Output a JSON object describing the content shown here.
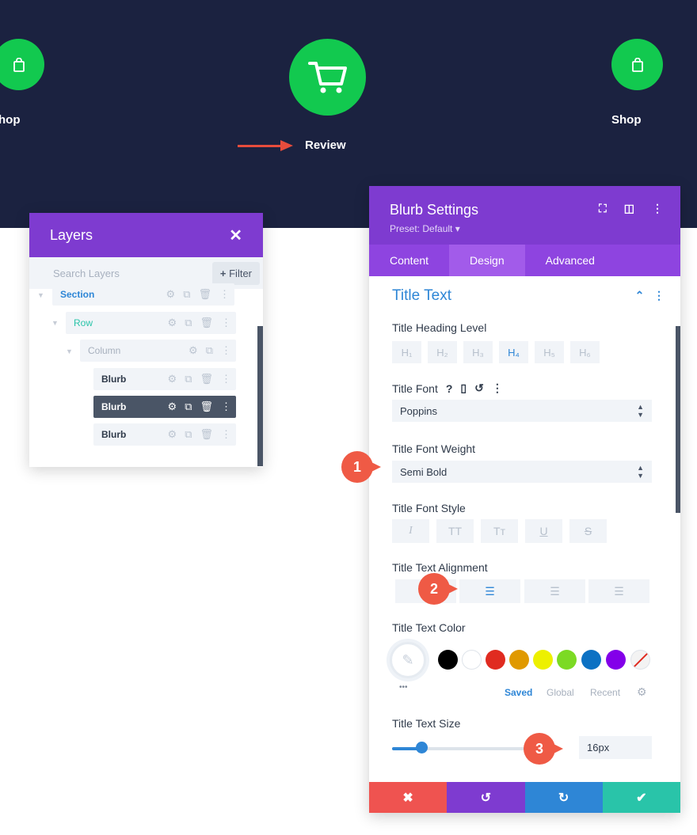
{
  "hero": {
    "left_label": "hop",
    "center_label": "Review",
    "right_label": "Shop",
    "accent": "#12c94f",
    "background": "#1b2240",
    "arrow_color": "#e74c3c",
    "icons": {
      "left": "shopping-bag-icon",
      "center": "shopping-cart-icon",
      "right": "shopping-bag-icon"
    }
  },
  "layers": {
    "title": "Layers",
    "close_icon": "close-icon",
    "search_placeholder": "Search Layers",
    "filter_label": "Filter",
    "filter_prefix": "+",
    "tree": [
      {
        "label": "Section",
        "color": "#2e86d6"
      },
      {
        "label": "Row",
        "color": "#29c4a9"
      },
      {
        "label": "Column",
        "color": "#a7b0bd"
      },
      {
        "label": "Blurb",
        "color": "#2f3a4a"
      },
      {
        "label": "Blurb",
        "color": "#ffffff",
        "selected": true
      },
      {
        "label": "Blurb",
        "color": "#2f3a4a"
      }
    ]
  },
  "settings": {
    "title": "Blurb Settings",
    "preset": "Preset: Default ▾",
    "tabs": [
      "Content",
      "Design",
      "Advanced"
    ],
    "active_tab": "Design",
    "section_title": "Title Text",
    "heading_level": {
      "label": "Title Heading Level",
      "options": [
        "H₁",
        "H₂",
        "H₃",
        "H₄",
        "H₅",
        "H₆"
      ],
      "selected": "H₄"
    },
    "font": {
      "label": "Title Font",
      "value": "Poppins",
      "help": "?"
    },
    "font_weight": {
      "label": "Title Font Weight",
      "value": "Semi Bold"
    },
    "font_style": {
      "label": "Title Font Style",
      "options": [
        "I",
        "TT",
        "Tт",
        "U",
        "S"
      ]
    },
    "alignment": {
      "label": "Title Text Alignment",
      "selected": "center"
    },
    "color": {
      "label": "Title Text Color",
      "swatches": [
        "#000000",
        "#ffffff",
        "#e02b20",
        "#e09900",
        "#edf000",
        "#7cda24",
        "#0c71c3",
        "#8300e9"
      ],
      "more": "•••",
      "tabs": [
        "Saved",
        "Global",
        "Recent"
      ],
      "active_tab": "Saved"
    },
    "text_size": {
      "label": "Title Text Size",
      "value": "16px",
      "slider_fraction": 0.2
    },
    "footer_colors": [
      "#ef5350",
      "#7e3bd0",
      "#2e86d6",
      "#29c4a9"
    ],
    "footer_icons": [
      "cancel-icon",
      "undo-icon",
      "redo-icon",
      "save-check-icon"
    ]
  },
  "markers": [
    "1",
    "2",
    "3"
  ]
}
